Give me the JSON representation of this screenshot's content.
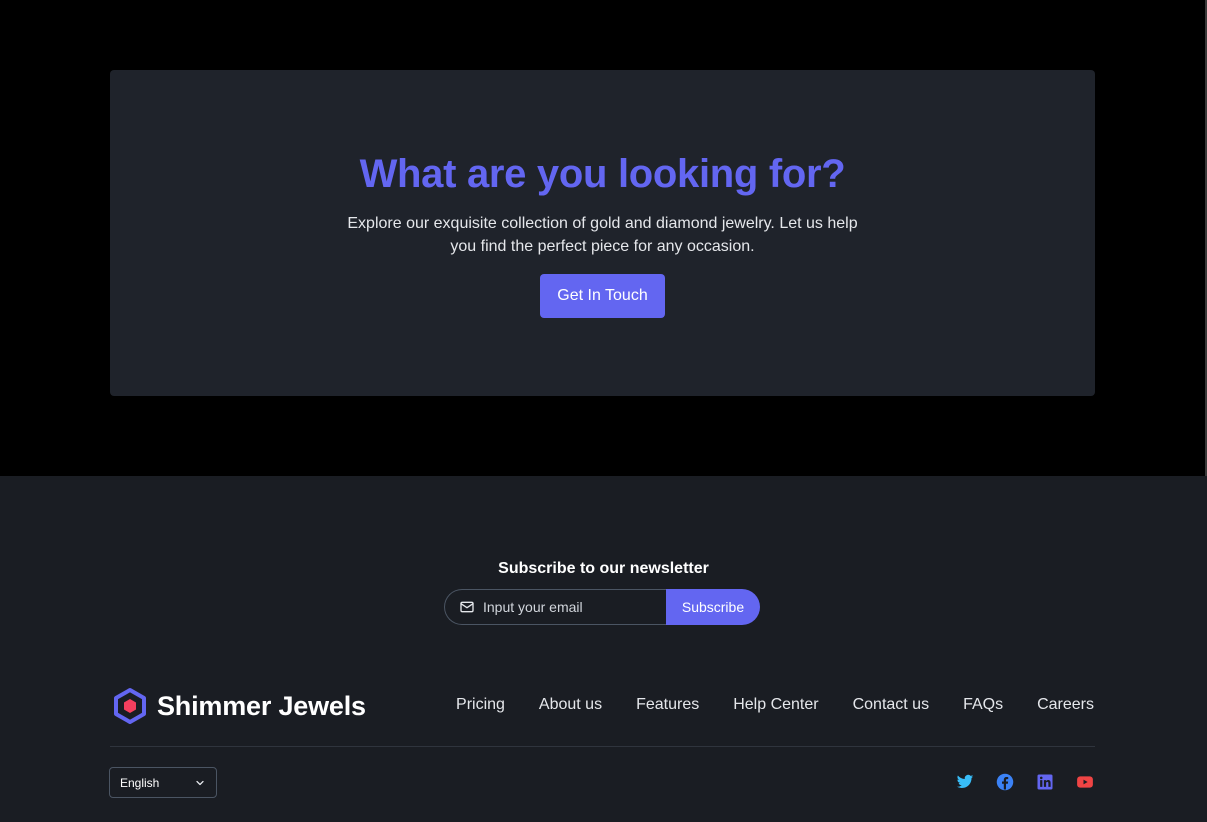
{
  "cta": {
    "title": "What are you looking for?",
    "description": "Explore our exquisite collection of gold and diamond jewelry. Let us help you find the perfect piece for any occasion.",
    "button_label": "Get In Touch"
  },
  "newsletter": {
    "title": "Subscribe to our newsletter",
    "placeholder": "Input your email",
    "button_label": "Subscribe"
  },
  "brand": {
    "name": "Shimmer Jewels",
    "logo_icon": "hexagon-logo-icon"
  },
  "footer_nav": [
    "Pricing",
    "About us",
    "Features",
    "Help Center",
    "Contact us",
    "FAQs",
    "Careers"
  ],
  "language": {
    "selected": "English"
  },
  "social": [
    {
      "icon": "twitter-icon",
      "color": "#38bdf8"
    },
    {
      "icon": "facebook-icon",
      "color": "#3b82f6"
    },
    {
      "icon": "linkedin-icon",
      "color": "#6366f1"
    },
    {
      "icon": "youtube-icon",
      "color": "#ef4444"
    }
  ],
  "colors": {
    "accent": "#6366f1",
    "card_bg": "#1f232b",
    "footer_bg": "#1a1d23"
  }
}
